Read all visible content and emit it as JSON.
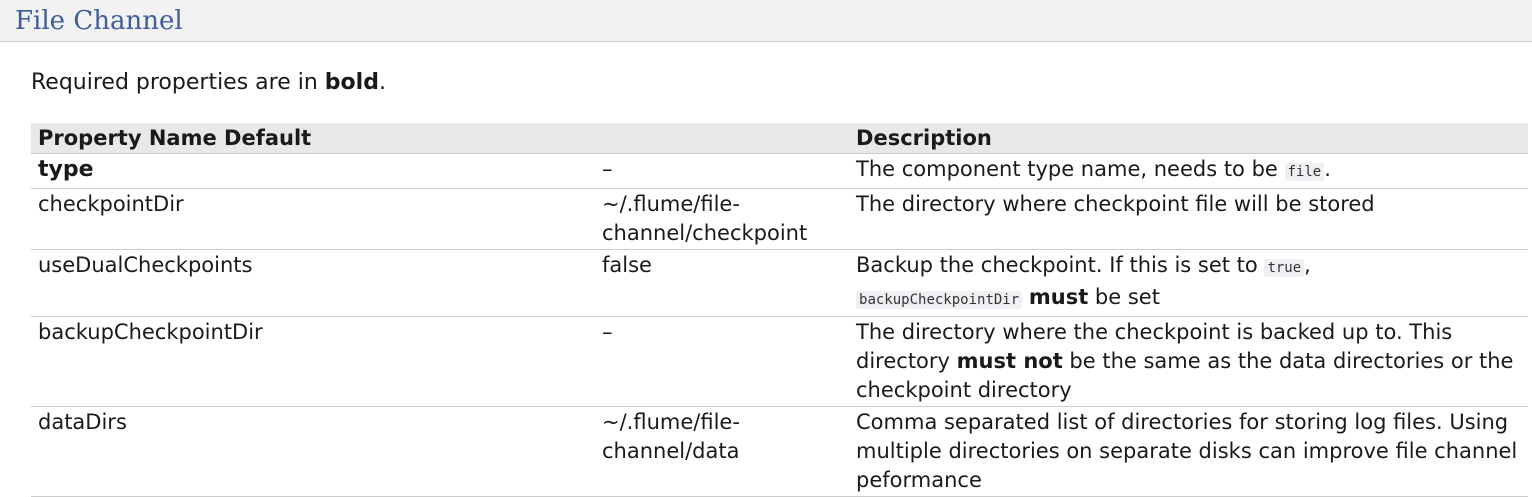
{
  "section": {
    "title": "File Channel"
  },
  "intro": {
    "prefix": "Required properties are in ",
    "bold_word": "bold",
    "suffix": "."
  },
  "table": {
    "headers": {
      "name_default": "Property Name Default",
      "description": "Description"
    },
    "rows": [
      {
        "name": "type",
        "default": "–",
        "desc_before": "The component type name, needs to be ",
        "desc_code": "file",
        "desc_after": "."
      },
      {
        "name": "checkpointDir",
        "default": "~/.flume/file-channel/checkpoint",
        "description": "The directory where checkpoint file will be stored"
      },
      {
        "name": "useDualCheckpoints",
        "default": "false",
        "desc_before": "Backup the checkpoint. If this is set to ",
        "desc_code": "true",
        "desc_mid": ", ",
        "desc_code2": "backupCheckpointDir",
        "desc_strong": "must",
        "desc_after": " be set"
      },
      {
        "name": "backupCheckpointDir",
        "default": "–",
        "desc_before": "The directory where the checkpoint is backed up to. This directory ",
        "desc_strong": "must not",
        "desc_after": " be the same as the data directories or the checkpoint directory"
      },
      {
        "name": "dataDirs",
        "default": "~/.flume/file-channel/data",
        "description": "Comma separated list of directories for storing log files. Using multiple directories on separate disks can improve file channel peformance"
      }
    ]
  }
}
